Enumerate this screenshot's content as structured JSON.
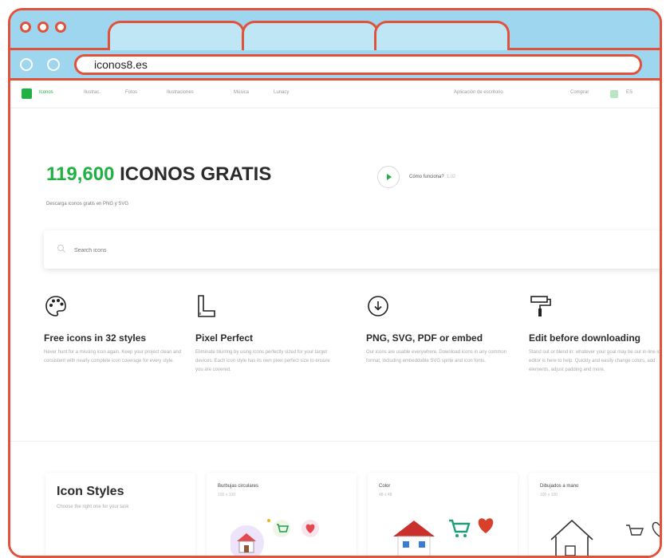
{
  "browser": {
    "url": "iconos8.es"
  },
  "nav": {
    "items": [
      "Iconos",
      "Ilustrac.",
      "Fotos",
      "Ilustraciones",
      "Música",
      "Lunacy"
    ],
    "right": [
      "Aplicación de escritorio",
      "Comprar",
      "ES"
    ]
  },
  "hero": {
    "count": "119,600",
    "title_rest": "ICONOS GRATIS",
    "subtitle": "Descarga iconos gratis en PNG y SVG",
    "video_label": "Cómo funciona?",
    "video_duration": "1:02",
    "accent_color": "#1fb141"
  },
  "search": {
    "placeholder": "Search icons"
  },
  "features": [
    {
      "icon": "palette-icon",
      "title": "Free icons in 32 styles",
      "text": "Never hunt for a missing icon again. Keep your project clean and consistent with nearly complete icon coverage for every style."
    },
    {
      "icon": "pixel-ruler-icon",
      "title": "Pixel Perfect",
      "text": "Eliminate blurring by using icons perfectly sized for your target devices. Each icon style has its own pixel perfect size to ensure you are covered."
    },
    {
      "icon": "download-circle-icon",
      "title": "PNG, SVG, PDF or embed",
      "text": "Our icons are usable everywhere. Download icons in any common format, including embeddable SVG sprite and icon fonts."
    },
    {
      "icon": "paint-roller-icon",
      "title": "Edit before downloading",
      "text": "Stand out or blend in: whatever your goal may be our in-line icon editor is here to help. Quickly and easily change colors, add elements, adjust padding and more."
    }
  ],
  "styles": {
    "title": "Icon Styles",
    "description": "Choose the right one for your task",
    "cards": [
      {
        "name": "Burbujas circulares",
        "size": "100 x 100"
      },
      {
        "name": "Color",
        "size": "48 x 48"
      },
      {
        "name": "Dibujados a mano",
        "size": "100 x 100"
      }
    ]
  }
}
